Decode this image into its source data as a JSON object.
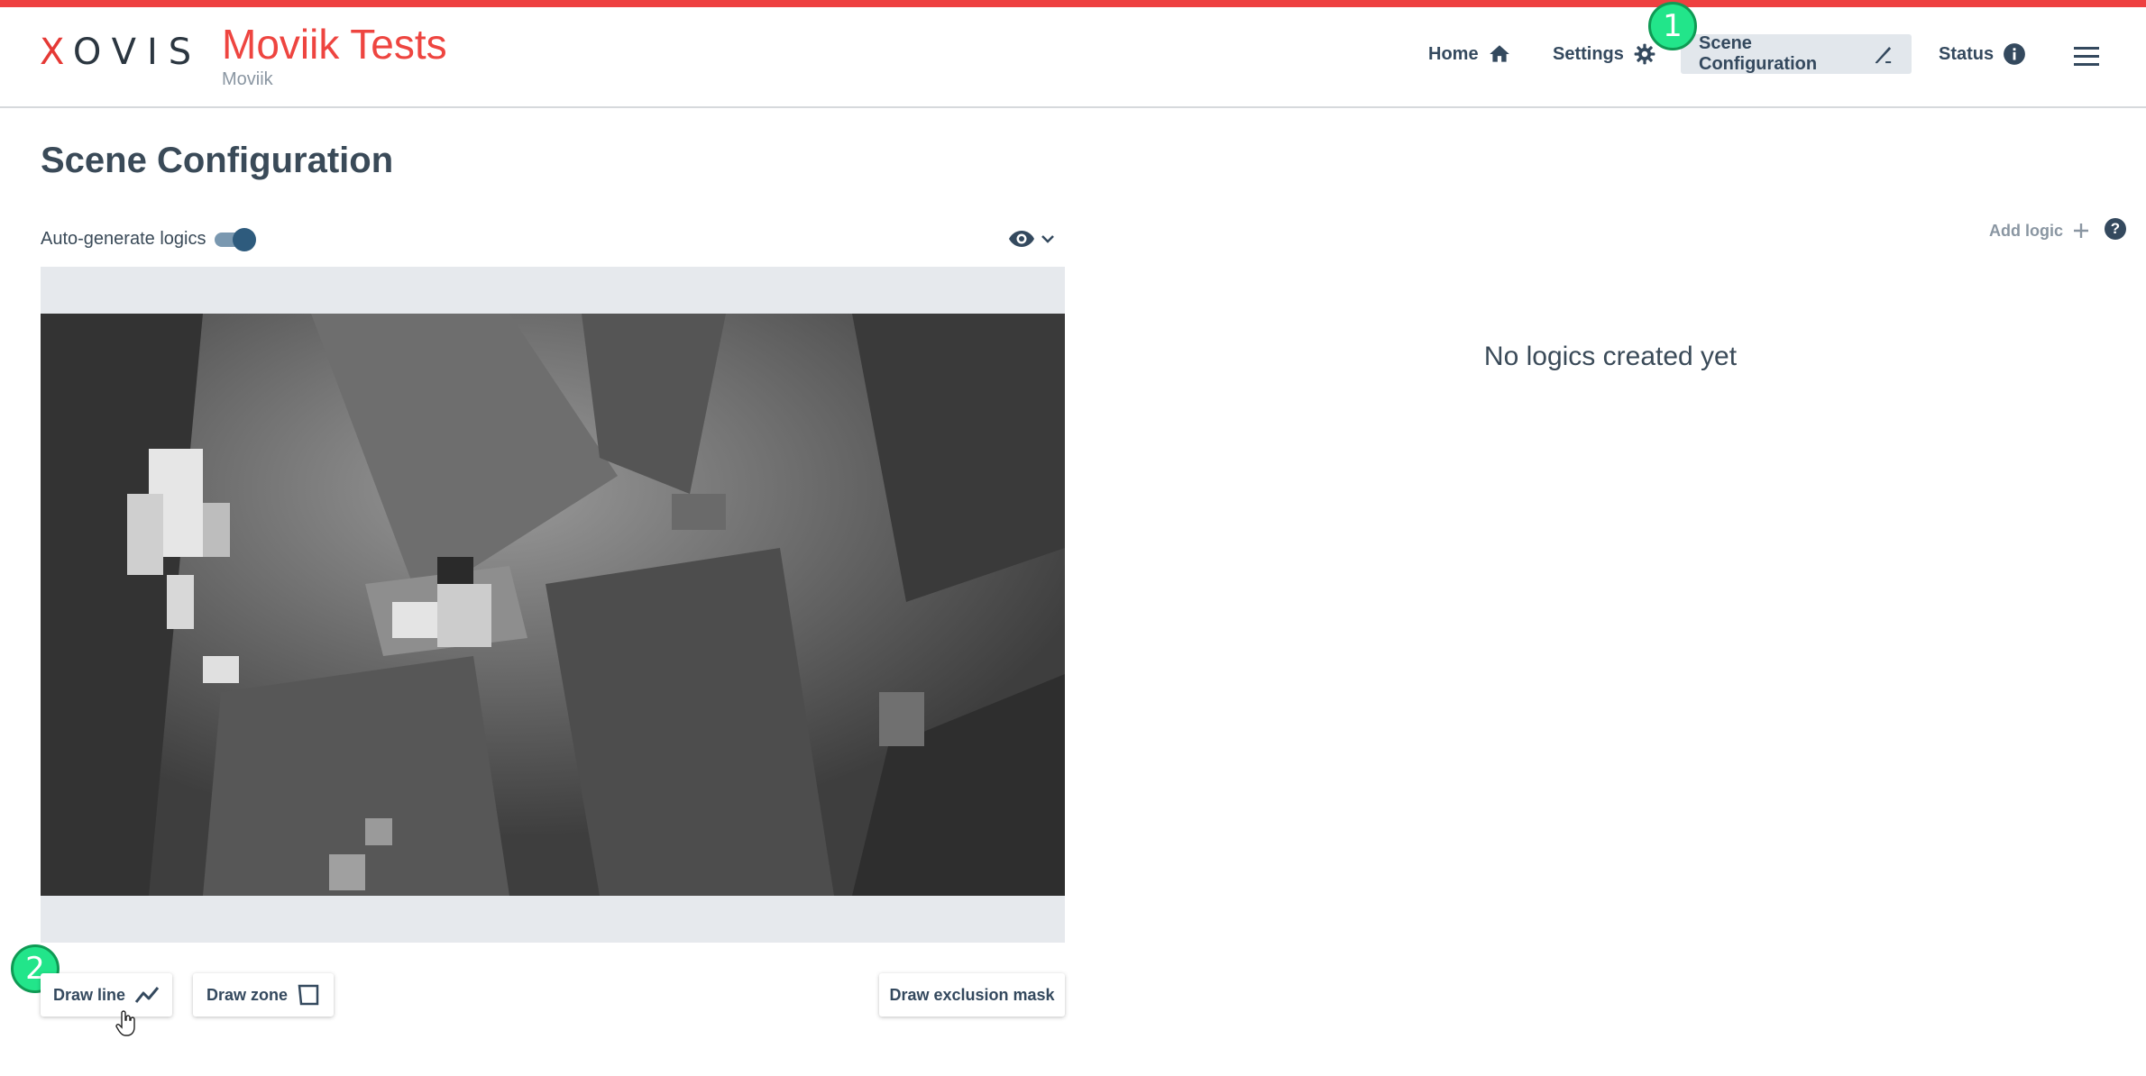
{
  "header": {
    "logo": "XOVIS",
    "title": "Moviik Tests",
    "subtitle": "Moviik"
  },
  "nav": {
    "home": "Home",
    "settings": "Settings",
    "scene_configuration": "Scene Configuration",
    "status": "Status",
    "active": "Scene Configuration"
  },
  "callouts": {
    "first": "1",
    "second": "2"
  },
  "page": {
    "title": "Scene Configuration"
  },
  "scene": {
    "auto_generate_label": "Auto-generate logics",
    "auto_generate_on": true
  },
  "actions": {
    "draw_line": "Draw line",
    "draw_zone": "Draw zone",
    "draw_exclusion_mask": "Draw exclusion mask"
  },
  "logics": {
    "add_logic": "Add logic",
    "help": "?",
    "empty_message": "No logics created yet"
  },
  "colors": {
    "brand_red": "#ee4540",
    "nav_text": "#34495e",
    "active_tab_bg": "#e2e7ec",
    "callout_green": "#22e58a",
    "toggle_knob": "#2e5b7d"
  },
  "icons": {
    "home": "home-icon",
    "settings": "gear-icon",
    "scene": "edit-pencil-icon",
    "status": "info-icon",
    "menu": "hamburger-menu-icon",
    "view": "eye-icon",
    "draw_line": "polyline-icon",
    "draw_zone": "polygon-icon",
    "add": "plus-icon",
    "help": "help-icon"
  }
}
